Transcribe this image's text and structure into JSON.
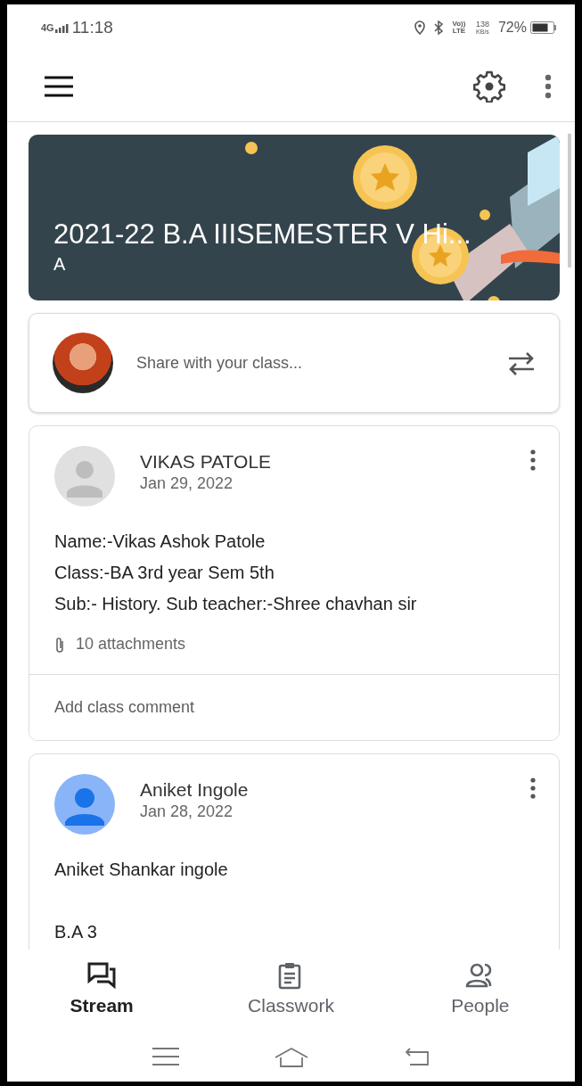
{
  "status_bar": {
    "network": "4G",
    "time": "11:18",
    "speed": "138",
    "speed_unit": "KB/s",
    "volte": "Vo)) LTE",
    "battery": "72%"
  },
  "class_banner": {
    "title": "2021-22 B.A IIISEMESTER V Hi...",
    "section": "A"
  },
  "share_box": {
    "placeholder": "Share with your class..."
  },
  "posts": [
    {
      "author": "VIKAS PATOLE",
      "date": "Jan 29, 2022",
      "kind": "gray",
      "paragraphs": [
        [
          "Name:-Vikas Ashok Patole",
          "Class:-BA 3rd year  Sem 5th",
          "Sub:- History.   Sub teacher:-Shree chavhan sir"
        ]
      ],
      "attachments": "10 attachments",
      "comment_placeholder": "Add class comment"
    },
    {
      "author": "Aniket Ingole",
      "date": "Jan 28, 2022",
      "kind": "blue",
      "paragraphs": [
        [
          "Aniket Shankar ingole"
        ],
        [
          "B.A 3"
        ]
      ]
    }
  ],
  "bottom_nav": [
    {
      "label": "Stream",
      "kind": "stream",
      "selected": true
    },
    {
      "label": "Classwork",
      "kind": "classwork",
      "selected": false
    },
    {
      "label": "People",
      "kind": "people",
      "selected": false
    }
  ]
}
